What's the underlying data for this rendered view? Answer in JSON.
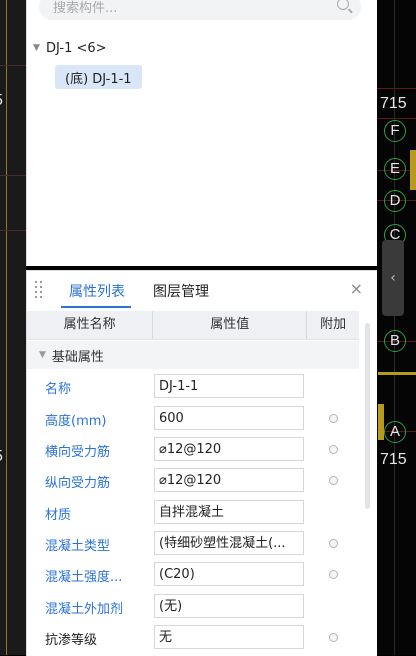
{
  "cad": {
    "axis_labels": [
      "F",
      "E",
      "D",
      "C",
      "B",
      "A"
    ],
    "dimension_texts": [
      "715",
      "715"
    ],
    "left_edge_digits": [
      "5",
      "5"
    ],
    "collapse_handle_glyph": "‹"
  },
  "tree_panel": {
    "search_placeholder": "搜索构件...",
    "root_node": "DJ-1 <6>",
    "child_node": "(底) DJ-1-1"
  },
  "prop_panel": {
    "tabs": [
      "属性列表",
      "图层管理"
    ],
    "active_tab": "属性列表",
    "close_glyph": "×",
    "columns": [
      "属性名称",
      "属性值",
      "附加"
    ],
    "group": "基础属性",
    "rows": [
      {
        "name": "名称",
        "value": "DJ-1-1",
        "checkbox": false,
        "name_color": "blue"
      },
      {
        "name": "高度(mm)",
        "value": "600",
        "checkbox": true,
        "name_color": "blue"
      },
      {
        "name": "横向受力筋",
        "value": "⌀12@120",
        "checkbox": true,
        "name_color": "blue"
      },
      {
        "name": "纵向受力筋",
        "value": "⌀12@120",
        "checkbox": true,
        "name_color": "blue"
      },
      {
        "name": "材质",
        "value": "自拌混凝土",
        "checkbox": false,
        "name_color": "blue"
      },
      {
        "name": "混凝土类型",
        "value": "(特细砂塑性混凝土(...",
        "checkbox": true,
        "name_color": "blue"
      },
      {
        "name": "混凝土强度...",
        "value": "(C20)",
        "checkbox": true,
        "name_color": "blue"
      },
      {
        "name": "混凝土外加剂",
        "value": "(无)",
        "checkbox": false,
        "name_color": "blue"
      },
      {
        "name": "抗渗等级",
        "value": "无",
        "checkbox": true,
        "name_color": "black"
      }
    ]
  }
}
